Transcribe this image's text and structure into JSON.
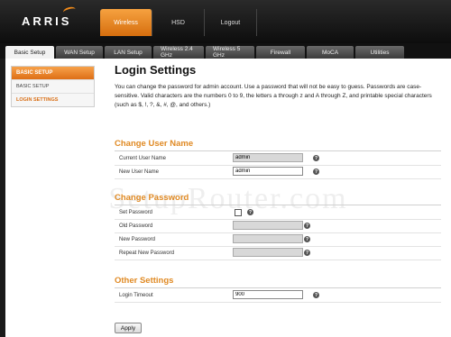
{
  "brand": {
    "logo": "ARRIS",
    "accent": "#e08a24"
  },
  "topnav": [
    {
      "label": "Wireless",
      "active": true
    },
    {
      "label": "HSD",
      "active": false
    },
    {
      "label": "Logout",
      "active": false
    }
  ],
  "tabs": [
    "Basic Setup",
    "WAN Setup",
    "LAN Setup",
    "Wireless 2.4 GHz",
    "Wireless 5 GHz",
    "Firewall",
    "MoCA",
    "Utilities"
  ],
  "sidebar": {
    "header": "BASIC SETUP",
    "items": [
      "BASIC SETUP",
      "LOGIN SETTINGS"
    ]
  },
  "main": {
    "title": "Login Settings",
    "description": "You can change the password for admin account. Use a password that will not be easy to guess. Passwords are case-sensitive. Valid characters are the numbers 0 to 9, the letters a through z and A through Z, and printable special characters (such as $, !, ?, &, #, @, and others.)"
  },
  "change_user": {
    "title": "Change User Name",
    "current_label": "Current User Name",
    "current_value": "admin",
    "new_label": "New User Name",
    "new_value": "admin"
  },
  "change_password": {
    "title": "Change Password",
    "set_label": "Set Password",
    "old_label": "Old Password",
    "new_label": "New Password",
    "repeat_label": "Repeat New Password"
  },
  "other": {
    "title": "Other Settings",
    "timeout_label": "Login Timeout",
    "timeout_value": "900"
  },
  "apply_label": "Apply",
  "help_glyph": "?",
  "watermark": "SetupRouter.com"
}
